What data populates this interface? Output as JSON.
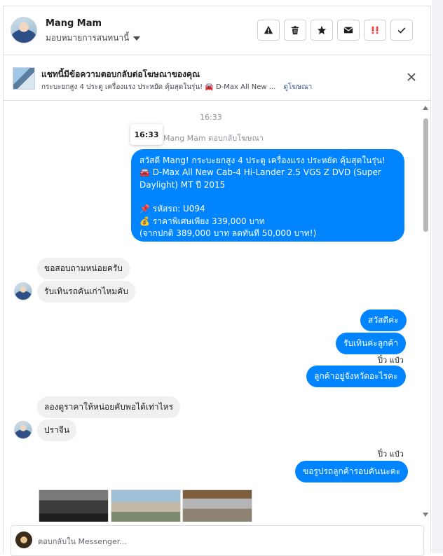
{
  "header": {
    "name": "Mang Mam",
    "assign_label": "มอบหมายการสนทนานี้",
    "buttons": [
      "report-icon",
      "trash-icon",
      "star-icon",
      "envelope-icon",
      "spam-icon",
      "check-icon"
    ]
  },
  "ad": {
    "title": "แชทนี้มีข้อความตอบกลับต่อโฆษณาของคุณ",
    "line": "กระบะยกสูง 4 ประตู เครื่องแรง ประหยัด คุ้มสุดในรุ่น! 🚘 D-Max All New ...",
    "link": "ดูโฆษณา"
  },
  "conversation": {
    "time": "16:33",
    "tooltip_time": "16:33",
    "system_line": "Mang Mam ตอบกลับโฆษณา",
    "first_message": [
      "สวัสดี Mang! กระบะยกสูง 4 ประตู เครื่องแรง ประหยัด คุ้มสุดในรุ่น!",
      "🚘 D-Max All New Cab-4 Hi-Lander 2.5 VGS Z DVD (Super",
      "Daylight) MT ปี 2015",
      "",
      "📌 รหัสรถ: U094",
      "💰 ราคาพิเศษเพียง 339,000 บาท",
      "(จากปกติ 389,000 บาท ลดทันที 50,000 บาท!)"
    ],
    "in1": "ขอสอบถามหน่อยครับ",
    "in2": "รับเทินรถคันเก่าไหมคับ",
    "out1": "สวัสดีค่ะ",
    "out2": "รับเทินค่ะลูกค้า",
    "sender1": "ปิ๋ว แป๋ว",
    "out3": "ลูกค้าอยู่จังหวัดอะไรคะ",
    "in3": "ลองดูราคาให้หน่อยคับพอได้เท่าไหร",
    "in4": "ปราจีน",
    "sender2": "ปิ๋ว แป๋ว",
    "out4": "ขอรูปรถลูกค้ารอบคันนะคะ"
  },
  "composer": {
    "placeholder": "ตอบกลับใน Messenger..."
  },
  "colors": {
    "outgoing": "#0084ff",
    "incoming": "#f1f0f0",
    "spam": "#fa3e3e"
  }
}
